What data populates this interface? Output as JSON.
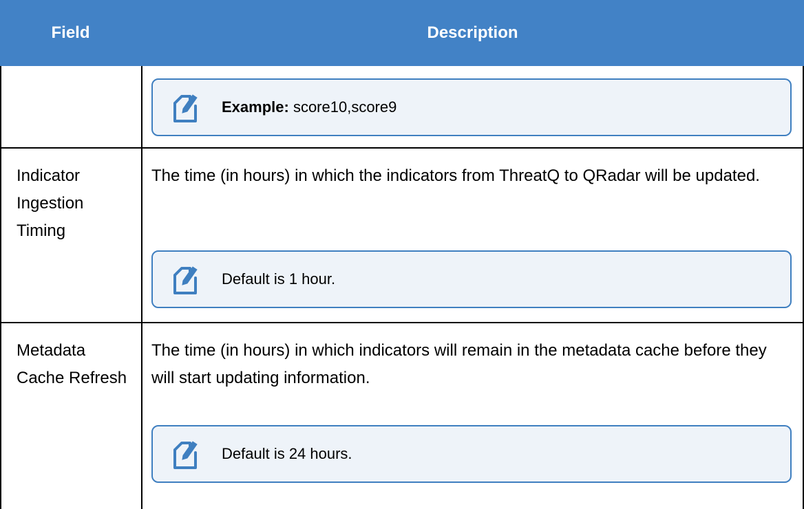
{
  "header": {
    "field_label": "Field",
    "description_label": "Description"
  },
  "rows": [
    {
      "field": "",
      "description": "",
      "note": {
        "label": "Example:",
        "text": " score10,score9",
        "icon": "note-icon"
      }
    },
    {
      "field": "Indicator Ingestion Timing",
      "description": "The time (in hours) in which the indicators from ThreatQ to QRadar will be updated.",
      "note": {
        "label": "",
        "text": "Default is 1 hour.",
        "icon": "note-icon"
      }
    },
    {
      "field": "Metadata Cache Refresh",
      "description": "The time (in hours) in which indicators will remain in the metadata cache before they will start updating information.",
      "note": {
        "label": "",
        "text": "Default is 24 hours.",
        "icon": "note-icon"
      }
    }
  ],
  "colors": {
    "header_bg": "#4282c6",
    "note_border": "#3f7fc0",
    "note_bg": "#eef3f9"
  }
}
